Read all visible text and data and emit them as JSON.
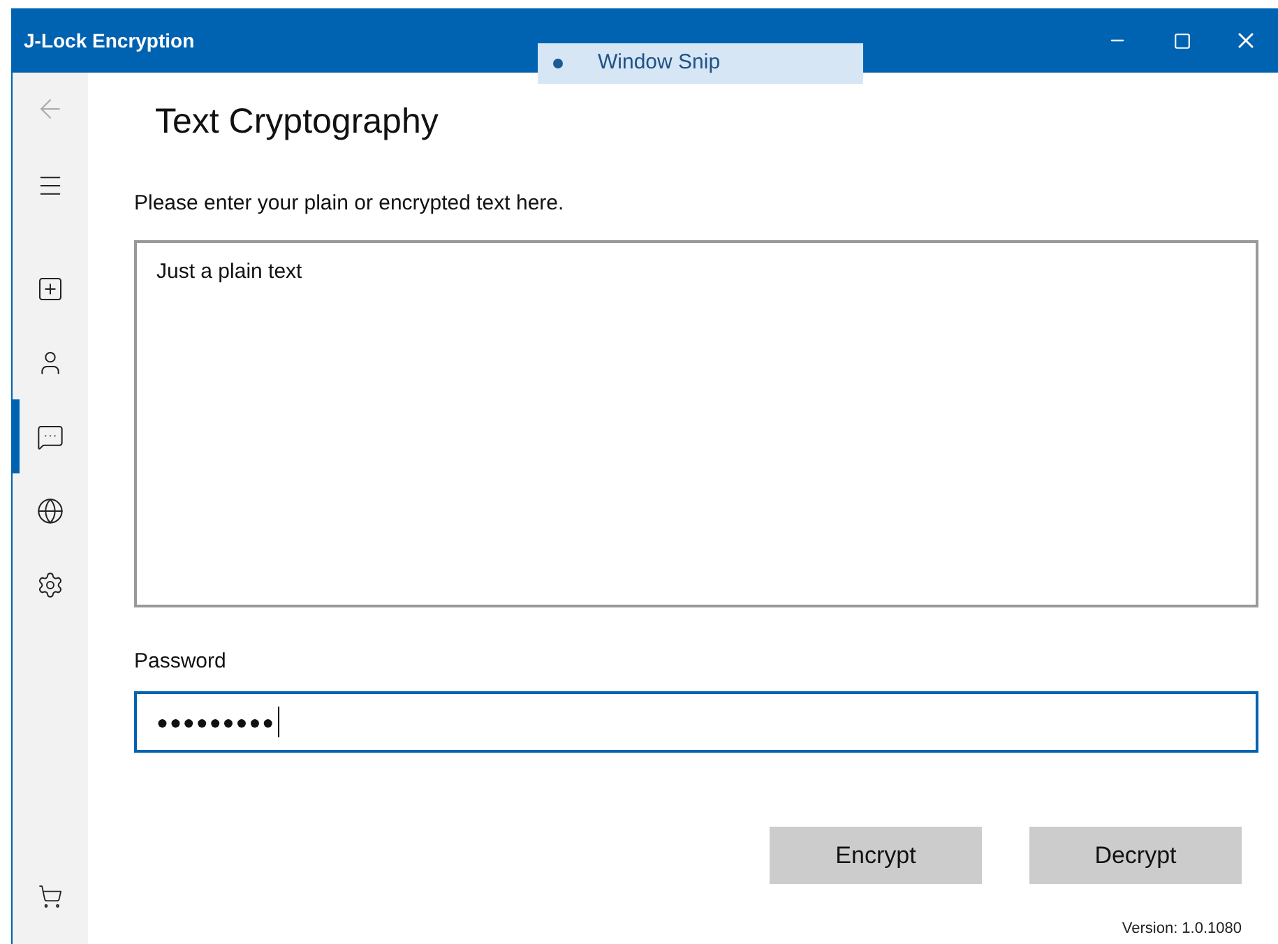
{
  "window": {
    "title": "J-Lock Encryption"
  },
  "overlay": {
    "label": "Window Snip"
  },
  "nav": {
    "items": [
      {
        "selected": false
      },
      {
        "selected": false
      },
      {
        "selected": true
      },
      {
        "selected": false
      },
      {
        "selected": false
      }
    ]
  },
  "page": {
    "title": "Text Cryptography",
    "prompt": "Please enter your plain or encrypted text here.",
    "text_value": "Just a plain text",
    "password_label": "Password",
    "password_value": "●●●●●●●●●",
    "password_focused": true
  },
  "buttons": [
    "Encrypt",
    "Decrypt"
  ],
  "version": "Version: 1.0.1080"
}
